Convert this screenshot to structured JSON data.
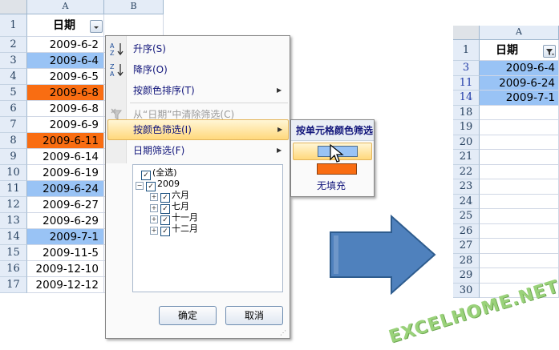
{
  "left_sheet": {
    "columns": [
      "A",
      "B"
    ],
    "header_row": {
      "row": "1",
      "label": "日期"
    },
    "rows": [
      {
        "row": "2",
        "value": "2009-6-2",
        "fill": ""
      },
      {
        "row": "3",
        "value": "2009-6-4",
        "fill": "#99c3f5"
      },
      {
        "row": "4",
        "value": "2009-6-5",
        "fill": ""
      },
      {
        "row": "5",
        "value": "2009-6-8",
        "fill": "#f96d12"
      },
      {
        "row": "6",
        "value": "2009-6-8",
        "fill": ""
      },
      {
        "row": "7",
        "value": "2009-6-9",
        "fill": ""
      },
      {
        "row": "8",
        "value": "2009-6-11",
        "fill": "#f96d12"
      },
      {
        "row": "9",
        "value": "2009-6-14",
        "fill": ""
      },
      {
        "row": "10",
        "value": "2009-6-19",
        "fill": ""
      },
      {
        "row": "11",
        "value": "2009-6-24",
        "fill": "#99c3f5"
      },
      {
        "row": "12",
        "value": "2009-6-27",
        "fill": ""
      },
      {
        "row": "13",
        "value": "2009-6-29",
        "fill": ""
      },
      {
        "row": "14",
        "value": "2009-7-1",
        "fill": "#99c3f5"
      },
      {
        "row": "15",
        "value": "2009-11-5",
        "fill": ""
      },
      {
        "row": "16",
        "value": "2009-12-10",
        "fill": ""
      },
      {
        "row": "17",
        "value": "2009-12-12",
        "fill": ""
      }
    ]
  },
  "filter_menu": {
    "sort_asc": "升序(S)",
    "sort_desc": "降序(O)",
    "sort_by_color": "按颜色排序(T)",
    "clear_filter": "从“日期”中清除筛选(C)",
    "filter_by_color": "按颜色筛选(I)",
    "date_filter": "日期筛选(F)",
    "tree": {
      "select_all": "(全选)",
      "year": "2009",
      "months": [
        "六月",
        "七月",
        "十一月",
        "十二月"
      ]
    },
    "ok": "确定",
    "cancel": "取消"
  },
  "color_submenu": {
    "title": "按单元格颜色筛选",
    "swatches": [
      "#99c3f5",
      "#f96d12"
    ],
    "no_fill": "无填充"
  },
  "right_sheet": {
    "column": "A",
    "header_row": {
      "row": "1",
      "label": "日期"
    },
    "filtered_rows": [
      {
        "row": "3",
        "value": "2009-6-4"
      },
      {
        "row": "11",
        "value": "2009-6-24"
      },
      {
        "row": "14",
        "value": "2009-7-1"
      }
    ],
    "empty_rows": [
      "18",
      "19",
      "20",
      "21",
      "22",
      "23",
      "24",
      "25",
      "26",
      "27",
      "28",
      "29",
      "30"
    ]
  },
  "watermark": "EXCELHOME.NET",
  "colors": {
    "highlight_blue": "#99c3f5",
    "highlight_orange": "#f96d12",
    "arrow_blue": "#4f81bd"
  }
}
